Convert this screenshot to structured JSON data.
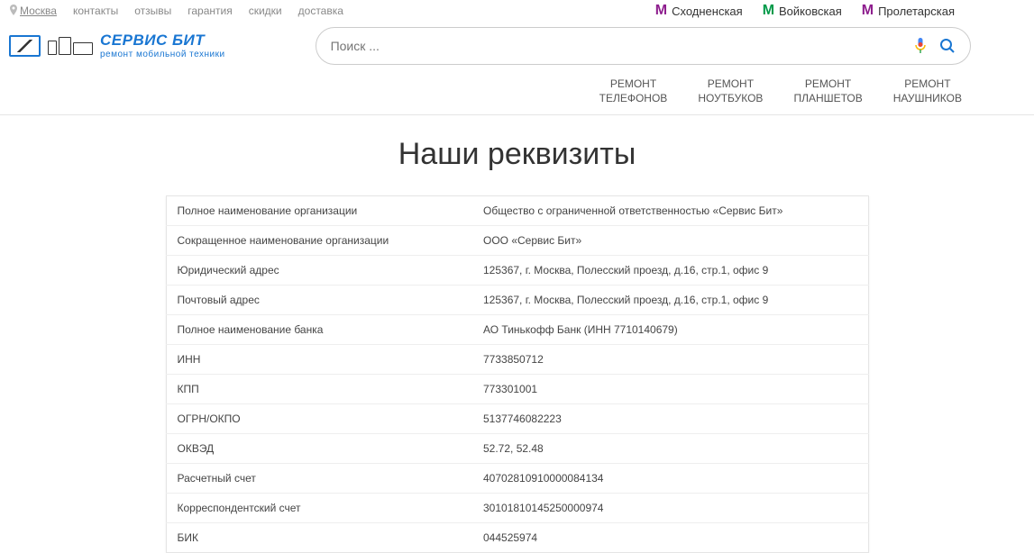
{
  "topbar": {
    "location": "Москва",
    "links": [
      "контакты",
      "отзывы",
      "гарантия",
      "скидки",
      "доставка"
    ]
  },
  "metro": [
    {
      "name": "Сходненская",
      "color": "#8e1e8e"
    },
    {
      "name": "Войковская",
      "color": "#009a49"
    },
    {
      "name": "Пролетарская",
      "color": "#8e1e8e"
    }
  ],
  "brand": {
    "line1": "СЕРВИС БИТ",
    "line2": "ремонт мобильной техники"
  },
  "search": {
    "placeholder": "Поиск ..."
  },
  "nav": [
    {
      "l1": "РЕМОНТ",
      "l2": "ТЕЛЕФОНОВ"
    },
    {
      "l1": "РЕМОНТ",
      "l2": "НОУТБУКОВ"
    },
    {
      "l1": "РЕМОНТ",
      "l2": "ПЛАНШЕТОВ"
    },
    {
      "l1": "РЕМОНТ",
      "l2": "НАУШНИКОВ"
    }
  ],
  "title": "Наши реквизиты",
  "requisites": [
    {
      "label": "Полное наименование организации",
      "value": "Общество с ограниченной ответственностью «Сервис Бит»"
    },
    {
      "label": "Сокращенное наименование организации",
      "value": "ООО «Сервис Бит»"
    },
    {
      "label": "Юридический адрес",
      "value": "125367, г. Москва, Полесский проезд, д.16, стр.1, офис 9"
    },
    {
      "label": "Почтовый адрес",
      "value": "125367, г. Москва, Полесский проезд, д.16, стр.1, офис 9"
    },
    {
      "label": "Полное наименование банка",
      "value": "АО Тинькофф Банк (ИНН 7710140679)"
    },
    {
      "label": "ИНН",
      "value": "7733850712"
    },
    {
      "label": "КПП",
      "value": "773301001"
    },
    {
      "label": "ОГРН/ОКПО",
      "value": "5137746082223"
    },
    {
      "label": "ОКВЭД",
      "value": "52.72, 52.48"
    },
    {
      "label": "Расчетный счет",
      "value": "40702810910000084134"
    },
    {
      "label": "Корреспондентский счет",
      "value": "30101810145250000974"
    },
    {
      "label": "БИК",
      "value": "044525974"
    }
  ]
}
